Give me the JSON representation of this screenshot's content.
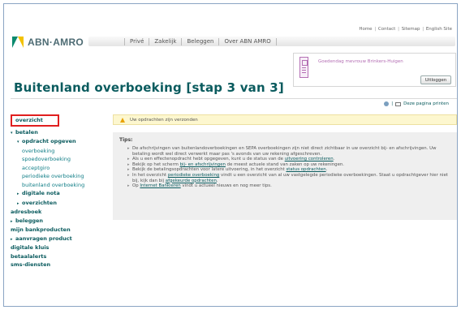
{
  "header": {
    "top_links": [
      "Home",
      "Contact",
      "Sitemap",
      "English Site"
    ],
    "logo_text": "ABN·AMRO",
    "nav_items": [
      "Privé",
      "Zakelijk",
      "Beleggen",
      "Over ABN AMRO"
    ],
    "greeting": "Goedendag mevrouw Brinkers-Huigen",
    "logout_label": "Uitloggen"
  },
  "page": {
    "title": "Buitenland overboeking [stap 3 van 3]",
    "print_label": "Deze pagina printen"
  },
  "sidebar": {
    "overzicht": "overzicht",
    "betalen": "betalen",
    "opdracht_opgeven": "opdracht opgeven",
    "sub_items": [
      "overboeking",
      "spoedoverboeking",
      "acceptgiro",
      "periodieke overboeking",
      "buitenland overboeking"
    ],
    "digitale_nota": "digitale nota",
    "overzichten": "overzichten",
    "bottom_items": [
      "adresboek",
      "beleggen",
      "mijn bankproducten",
      "aanvragen product",
      "digitale kluis",
      "betaalalerts",
      "sms-diensten"
    ]
  },
  "content": {
    "message": "Uw opdrachten zijn verzonden",
    "tips_title": "Tips:",
    "tips": {
      "t1": "De afschrijvingen van buitenlandoverboekingen en SEPA overboekingen zijn niet direct zichtbaar in uw overzicht bij- en afschrijvingen. Uw betaling wordt wel direct verwerkt maar pas 's avonds van uw rekening afgeschreven.",
      "t2a": "Als u een effectenopdracht hebt opgegeven, kunt u de status van de ",
      "t2link": "uitvoering controleren",
      "t2b": ".",
      "t3a": "Bekijk op het scherm ",
      "t3link": "bij- en afschrijvingen",
      "t3b": " de meest actuele stand van zaken op uw rekeningen.",
      "t4a": "Bekijk de betalingsopdrachten voor latere uitvoering, in het overzicht ",
      "t4link": "status opdrachten",
      "t4b": ".",
      "t5a": "In het overzicht ",
      "t5link1": "periodieke overboeking",
      "t5b": " vindt u een overzicht van al uw vastgelegde periodieke overboekingen. Staat u opdrachtgever hier niet bij, kijk dan bij ",
      "t5link2": "afgekeurde opdrachten",
      "t5c": ".",
      "t6a": "Op ",
      "t6link": "Internet Bankieren",
      "t6b": " vindt u actueel nieuws en nog meer tips."
    }
  }
}
